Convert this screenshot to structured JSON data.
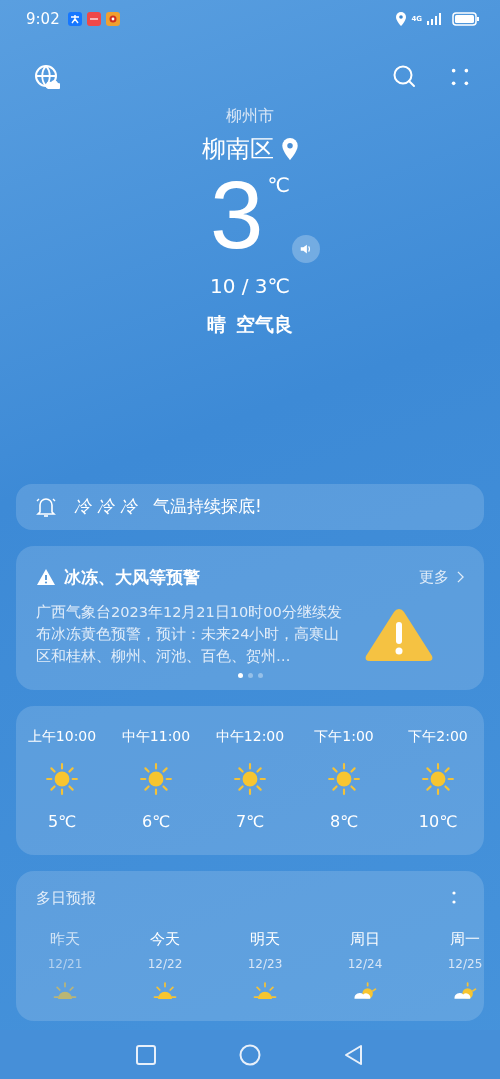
{
  "status_bar": {
    "time": "9:02",
    "network": "4G"
  },
  "location": {
    "city": "柳州市",
    "district": "柳南区"
  },
  "current": {
    "temperature": "3",
    "unit": "℃",
    "range": "10 / 3℃",
    "condition": "晴",
    "air_quality": "空气良"
  },
  "notice": {
    "effect_text": "冷冷冷",
    "message": "气温持续探底!"
  },
  "warning": {
    "title": "冰冻、大风等预警",
    "more": "更多",
    "body": "广西气象台2023年12月21日10时00分继续发布冰冻黄色预警，预计：未来24小时，高寒山区和桂林、柳州、河池、百色、贺州…",
    "pages": [
      {
        "selected": true
      },
      {
        "selected": false
      },
      {
        "selected": false
      }
    ]
  },
  "hourly": [
    {
      "time": "上午10:00",
      "kind": "sunny",
      "temp": "5℃"
    },
    {
      "time": "中午11:00",
      "kind": "sunny",
      "temp": "6℃"
    },
    {
      "time": "中午12:00",
      "kind": "sunny",
      "temp": "7℃"
    },
    {
      "time": "下午1:00",
      "kind": "sunny",
      "temp": "8℃"
    },
    {
      "time": "下午2:00",
      "kind": "sunny",
      "temp": "10℃"
    }
  ],
  "daily": {
    "title": "多日预报",
    "days": [
      {
        "day": "昨天",
        "date": "12/21",
        "kind": "sunny",
        "past": true
      },
      {
        "day": "今天",
        "date": "12/22",
        "kind": "sunny",
        "past": false
      },
      {
        "day": "明天",
        "date": "12/23",
        "kind": "sunny",
        "past": false
      },
      {
        "day": "周日",
        "date": "12/24",
        "kind": "partly_cloudy",
        "past": false
      },
      {
        "day": "周一",
        "date": "12/25",
        "kind": "partly_cloudy",
        "past": false
      }
    ]
  }
}
